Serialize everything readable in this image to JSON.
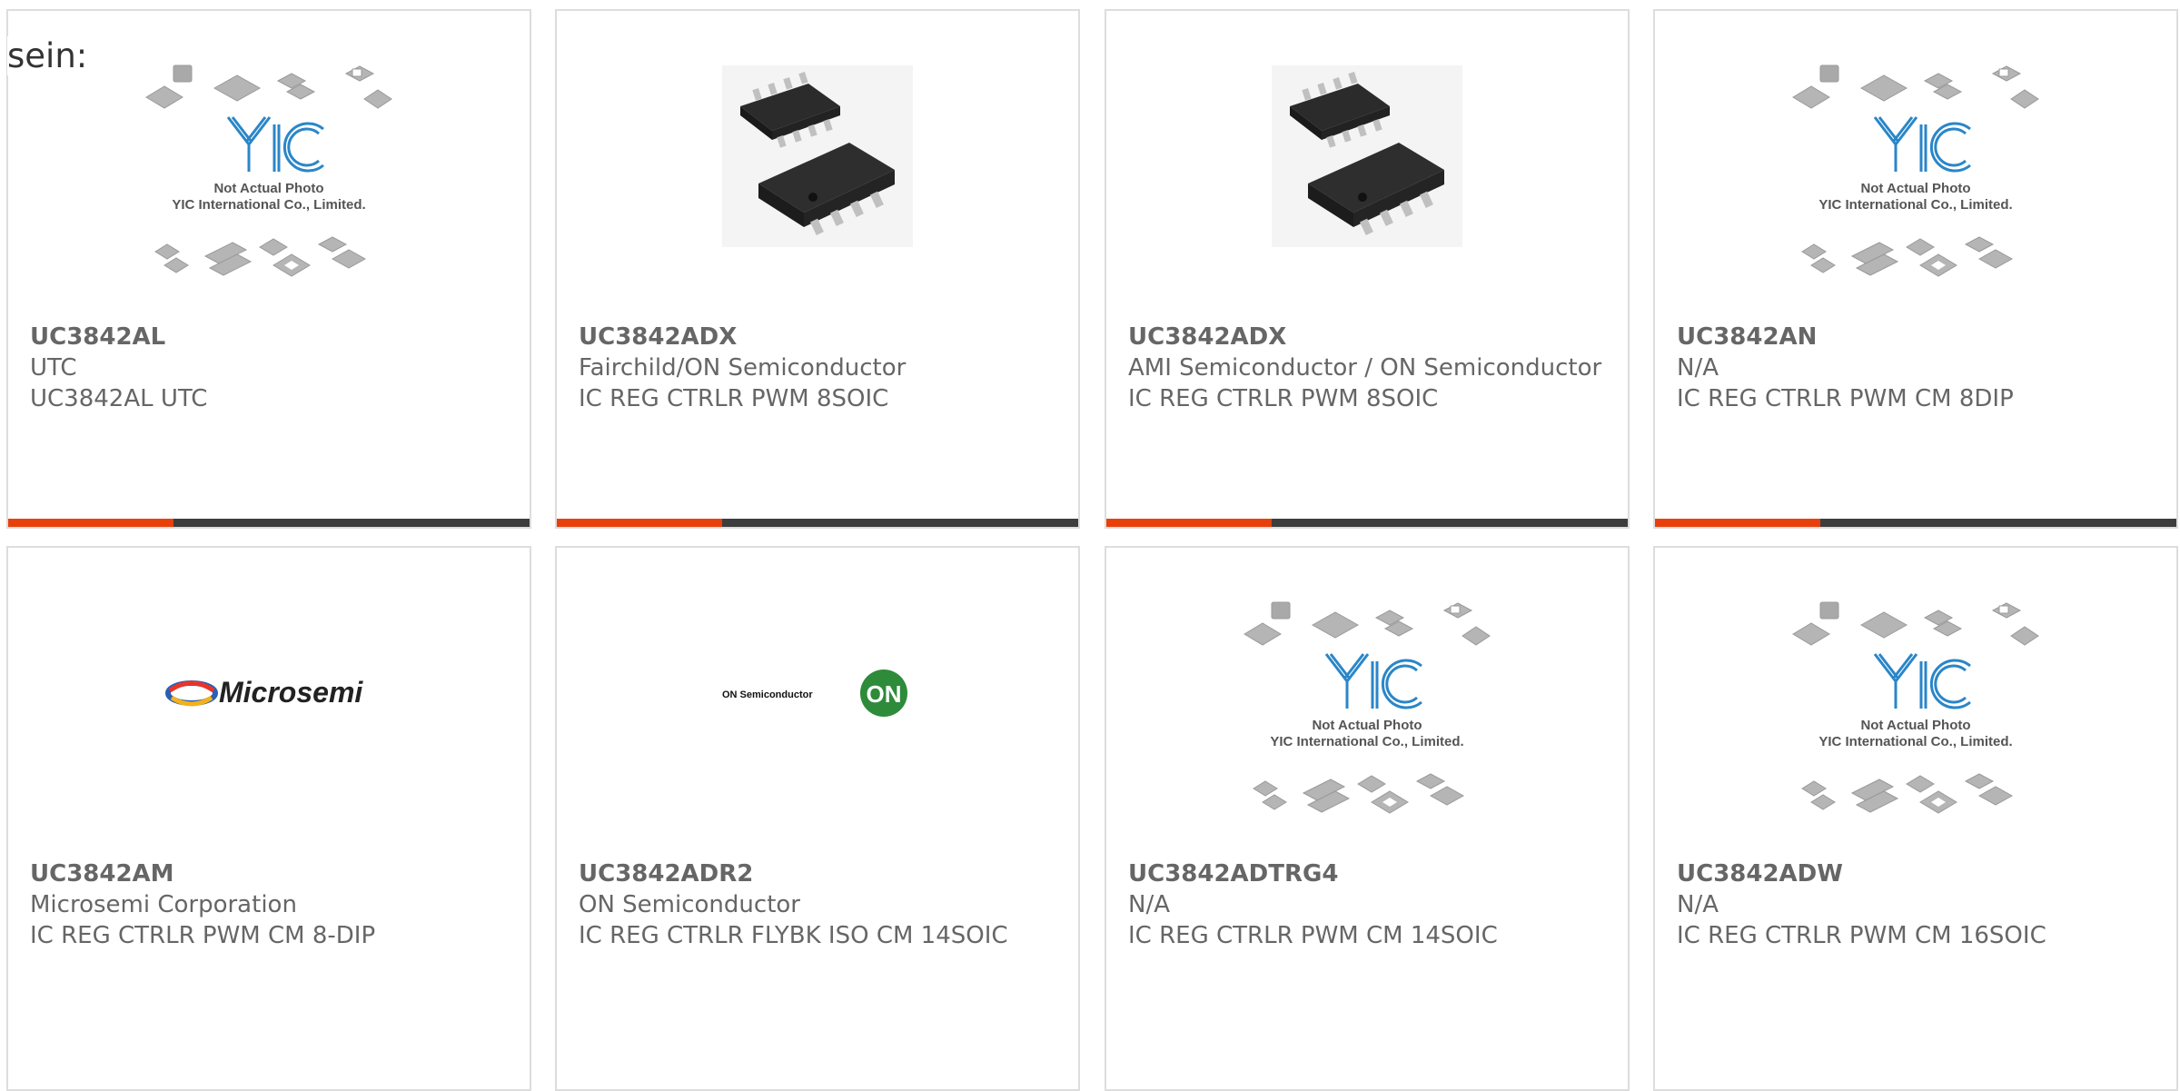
{
  "page": {
    "fragment_text": "sein:"
  },
  "placeholder_image": {
    "line1": "Not Actual Photo",
    "line2": "YIC International Co., Limited."
  },
  "logos": {
    "microsemi": "Microsemi",
    "on_semi_text": "ON Semiconductor",
    "on_semi_badge": "ON"
  },
  "colors": {
    "accent": "#e8400c",
    "bar": "#3d3d3d",
    "yic_blue": "#2a86c8",
    "on_green": "#2e8b3a"
  },
  "cards": [
    {
      "pn": "UC3842AL",
      "mfr": "UTC",
      "desc": "UC3842AL UTC",
      "image": "yic-placeholder"
    },
    {
      "pn": "UC3842ADX",
      "mfr": "Fairchild/ON Semiconductor",
      "desc": "IC REG CTRLR PWM 8SOIC",
      "image": "soic-chip"
    },
    {
      "pn": "UC3842ADX",
      "mfr": "AMI Semiconductor / ON Semiconductor",
      "desc": "IC REG CTRLR PWM 8SOIC",
      "image": "soic-chip"
    },
    {
      "pn": "UC3842AN",
      "mfr": "N/A",
      "desc": "IC REG CTRLR PWM CM 8DIP",
      "image": "yic-placeholder"
    },
    {
      "pn": "UC3842AM",
      "mfr": "Microsemi Corporation",
      "desc": "IC REG CTRLR PWM CM 8-DIP",
      "image": "microsemi-logo"
    },
    {
      "pn": "UC3842ADR2",
      "mfr": "ON Semiconductor",
      "desc": "IC REG CTRLR FLYBK ISO CM 14SOIC",
      "image": "onsemi-logo"
    },
    {
      "pn": "UC3842ADTRG4",
      "mfr": "N/A",
      "desc": "IC REG CTRLR PWM CM 14SOIC",
      "image": "yic-placeholder"
    },
    {
      "pn": "UC3842ADW",
      "mfr": "N/A",
      "desc": "IC REG CTRLR PWM CM 16SOIC",
      "image": "yic-placeholder"
    }
  ]
}
